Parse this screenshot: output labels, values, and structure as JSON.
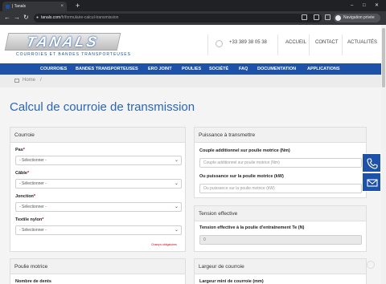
{
  "browser": {
    "tab_title": "| Tanals",
    "tab_close": "×",
    "new_tab": "+",
    "url_host": "tanals.com",
    "url_path": "/fr/formulaire-calcul-transmission",
    "incognito_label": "Navigation privée",
    "win_minimize": "–",
    "win_maximize": "□",
    "win_close": "✕",
    "back": "←",
    "forward": "→",
    "reload": "↻"
  },
  "header": {
    "logo_text": "TANALS",
    "logo_tagline": "COURROIES ET BANDES TRANSPORTEUSES",
    "phone": "+33 389 38 05 38",
    "nav": [
      "ACCUEIL",
      "CONTACT",
      "ACTUALITÉS"
    ]
  },
  "menu": [
    "COURROIES",
    "BANDES TRANSPORTEUSES",
    "ERO JOINT",
    "POULIES",
    "SOCIÉTÉ",
    "FAQ",
    "DOCUMENTATION",
    "APPLICATIONS"
  ],
  "breadcrumb": {
    "home": "Home",
    "separator": "/"
  },
  "page_title": "Calcul de courroie de transmission",
  "courroie": {
    "title": "Courroie",
    "fields": [
      {
        "label": "Pas",
        "value": "- Sélectionner -"
      },
      {
        "label": "Câble",
        "value": "- Sélectionner -"
      },
      {
        "label": "Jonction",
        "value": "- Sélectionner -"
      },
      {
        "label": "Textile nylon",
        "value": "- Sélectionner -"
      }
    ],
    "required_mark": "*",
    "required_note": "Champs obligatoires"
  },
  "puissance": {
    "title": "Puissance à transmettre",
    "field1_label": "Couple additionnel sur poulie motrice (Nm)",
    "field1_placeholder": "Couple additionnel sur poulie motrice (Nm)",
    "field2_label": "Ou puissance sur la poulie motrice (kW)",
    "field2_placeholder": "Ou puissance sur la poulie motrice (kW)"
  },
  "tension": {
    "title": "Tension effective",
    "label": "Tension effective à la poulie d'entraînement Te (N)",
    "value": "0"
  },
  "poulie": {
    "title": "Poulie motrice",
    "field_label": "Nombre de dents"
  },
  "largeur": {
    "title": "Largeur de courroie",
    "field_label": "Largeur mini de courroie (mm)"
  },
  "colors": {
    "brand_blue": "#1d52a8",
    "title_blue": "#2a66b8",
    "required_red": "#d0021b"
  },
  "icons": [
    "phone-icon",
    "mail-icon",
    "home-icon",
    "lock-icon",
    "incognito-icon",
    "chevron-down-icon"
  ]
}
